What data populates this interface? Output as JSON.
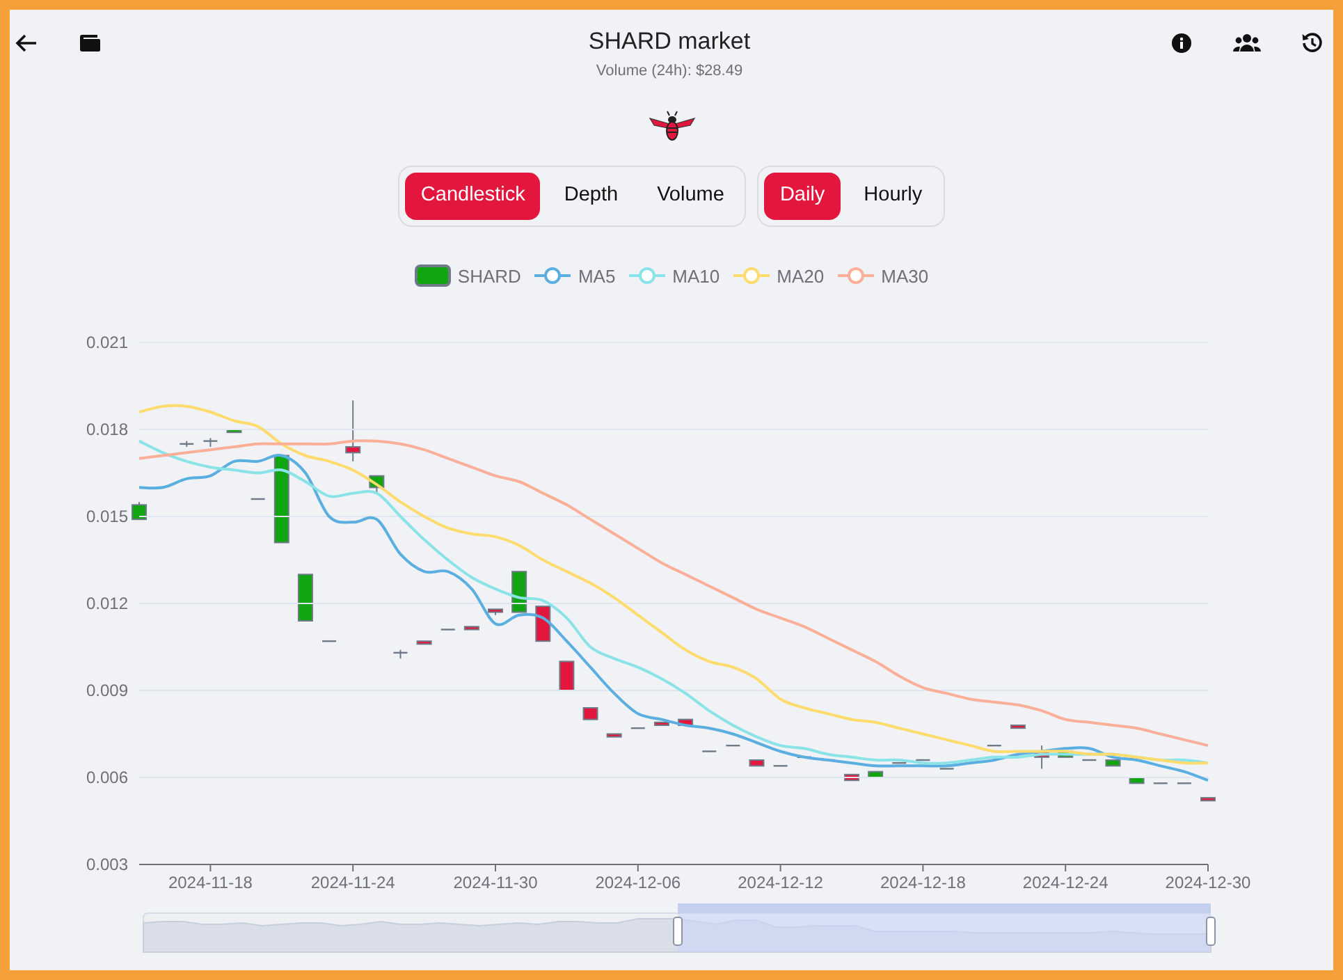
{
  "header": {
    "title": "SHARD market",
    "subtitle": "Volume (24h): $28.49"
  },
  "chart_types": [
    {
      "label": "Candlestick",
      "selected": true
    },
    {
      "label": "Depth",
      "selected": false
    },
    {
      "label": "Volume",
      "selected": false
    }
  ],
  "intervals": [
    {
      "label": "Daily",
      "selected": true
    },
    {
      "label": "Hourly",
      "selected": false
    }
  ],
  "chart": {
    "candle_series": {
      "name": "SHARD",
      "color": "#11a511"
    },
    "chart_data": {
      "type": "line",
      "grid": true,
      "categories": [
        null,
        null,
        null,
        "2024-11-18",
        null,
        null,
        null,
        null,
        null,
        "2024-11-24",
        null,
        null,
        null,
        null,
        null,
        "2024-11-30",
        null,
        null,
        null,
        null,
        null,
        "2024-12-06",
        null,
        null,
        null,
        null,
        null,
        "2024-12-12",
        null,
        null,
        null,
        null,
        null,
        "2024-12-18",
        null,
        null,
        null,
        null,
        null,
        "2024-12-24",
        null,
        null,
        null,
        null,
        null,
        "2024-12-30"
      ],
      "ylim": [
        0.003,
        0.021
      ],
      "yticks": [
        0.003,
        0.006,
        0.009,
        0.012,
        0.015,
        0.018,
        0.021
      ],
      "series": [
        {
          "name": "MA5",
          "color": "#5aaee0",
          "values": [
            0.016,
            0.016,
            0.0163,
            0.0164,
            0.0169,
            0.0169,
            0.0171,
            0.0165,
            0.015,
            0.0148,
            0.0149,
            0.0137,
            0.0131,
            0.0131,
            0.0125,
            0.0113,
            0.0116,
            0.0115,
            0.0107,
            0.0098,
            0.0089,
            0.0082,
            0.008,
            0.0078,
            0.0077,
            0.0075,
            0.0072,
            0.0069,
            0.0067,
            0.0066,
            0.0065,
            0.0064,
            0.0064,
            0.0064,
            0.0064,
            0.0065,
            0.0066,
            0.0068,
            0.0069,
            0.007,
            0.007,
            0.0067,
            0.0066,
            0.0064,
            0.0062,
            0.0059
          ]
        },
        {
          "name": "MA10",
          "color": "#8ae3e6",
          "values": [
            0.0176,
            0.0172,
            0.0169,
            0.0167,
            0.0166,
            0.0165,
            0.0166,
            0.0162,
            0.0157,
            0.0158,
            0.0158,
            0.015,
            0.0142,
            0.0135,
            0.0129,
            0.0125,
            0.0122,
            0.0121,
            0.0115,
            0.0105,
            0.0101,
            0.0098,
            0.0094,
            0.0089,
            0.0083,
            0.0078,
            0.0074,
            0.0071,
            0.007,
            0.0068,
            0.0067,
            0.0066,
            0.0066,
            0.0065,
            0.0065,
            0.0066,
            0.0067,
            0.0067,
            0.0068,
            0.0068,
            0.0068,
            0.0068,
            0.0067,
            0.0066,
            0.0066,
            0.0065
          ]
        },
        {
          "name": "MA20",
          "color": "#fddb6d",
          "values": [
            0.0186,
            0.0188,
            0.0188,
            0.0186,
            0.0183,
            0.0181,
            0.0175,
            0.0171,
            0.0169,
            0.0166,
            0.0161,
            0.0155,
            0.015,
            0.0146,
            0.0144,
            0.0143,
            0.014,
            0.0135,
            0.0131,
            0.0127,
            0.0122,
            0.0116,
            0.011,
            0.0104,
            0.01,
            0.0098,
            0.0094,
            0.0087,
            0.0084,
            0.0082,
            0.008,
            0.0079,
            0.0077,
            0.0075,
            0.0073,
            0.0071,
            0.0069,
            0.0069,
            0.0069,
            0.0069,
            0.0068,
            0.0068,
            0.0067,
            0.0066,
            0.0065,
            0.0065
          ]
        },
        {
          "name": "MA30",
          "color": "#fbaf98",
          "values": [
            0.017,
            0.0171,
            0.0172,
            0.0173,
            0.0174,
            0.0175,
            0.0175,
            0.0175,
            0.0175,
            0.0176,
            0.0176,
            0.0175,
            0.0173,
            0.017,
            0.0167,
            0.0164,
            0.0162,
            0.0158,
            0.0154,
            0.0149,
            0.0144,
            0.0139,
            0.0134,
            0.013,
            0.0126,
            0.0122,
            0.0118,
            0.0115,
            0.0112,
            0.0108,
            0.0104,
            0.01,
            0.0095,
            0.0091,
            0.0089,
            0.0087,
            0.0086,
            0.0085,
            0.0083,
            0.008,
            0.0079,
            0.0078,
            0.0077,
            0.0075,
            0.0073,
            0.0071
          ]
        }
      ]
    }
  }
}
